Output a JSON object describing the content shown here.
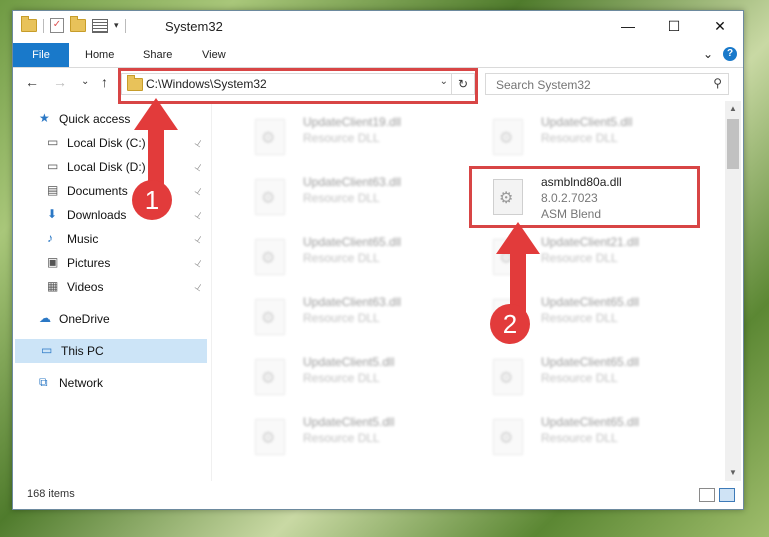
{
  "window": {
    "title": "System32",
    "controls": {
      "minimize": "—",
      "maximize": "☐",
      "close": "✕"
    }
  },
  "ribbon": {
    "tabs": [
      "File",
      "Home",
      "Share",
      "View"
    ],
    "expand": "⌄",
    "help": "?"
  },
  "navigation": {
    "back": "←",
    "forward": "→",
    "recent": "⌄",
    "up": "↑",
    "address": "C:\\Windows\\System32",
    "address_dropdown": "⌄",
    "refresh": "↻"
  },
  "search": {
    "placeholder": "Search System32",
    "icon": "⚲"
  },
  "sidebar": {
    "items": [
      {
        "label": "Quick access",
        "icon": "star-icon",
        "pinned": false
      },
      {
        "label": "Local Disk (C:)",
        "icon": "drive-icon",
        "pinned": true
      },
      {
        "label": "Local Disk (D:)",
        "icon": "drive-icon",
        "pinned": true
      },
      {
        "label": "Documents",
        "icon": "documents-icon",
        "pinned": true
      },
      {
        "label": "Downloads",
        "icon": "downloads-icon",
        "pinned": true
      },
      {
        "label": "Music",
        "icon": "music-icon",
        "pinned": true
      },
      {
        "label": "Pictures",
        "icon": "pictures-icon",
        "pinned": true
      },
      {
        "label": "Videos",
        "icon": "videos-icon",
        "pinned": true
      },
      {
        "label": "OneDrive",
        "icon": "cloud-icon",
        "pinned": false
      },
      {
        "label": "This PC",
        "icon": "computer-icon",
        "pinned": false,
        "selected": true
      },
      {
        "label": "Network",
        "icon": "network-icon",
        "pinned": false
      }
    ],
    "pin_glyph": "📌"
  },
  "files": {
    "left_column": [
      {
        "name": "UpdateClient19.dll",
        "type": "Resource DLL"
      },
      {
        "name": "UpdateClient63.dll",
        "type": "Resource DLL"
      },
      {
        "name": "UpdateClient65.dll",
        "type": "Resource DLL"
      },
      {
        "name": "UpdateClient63.dll",
        "type": "Resource DLL"
      },
      {
        "name": "UpdateClient5.dll",
        "type": "Resource DLL"
      },
      {
        "name": "UpdateClient5.dll",
        "type": "Resource DLL"
      }
    ],
    "right_column": [
      {
        "name": "UpdateClient5.dll",
        "type": "Resource DLL"
      },
      {
        "name": "UpdateClient21.dll",
        "type": "Resource DLL"
      },
      {
        "name": "UpdateClient65.dll",
        "type": "Resource DLL"
      },
      {
        "name": "UpdateClient65.dll",
        "type": "Resource DLL"
      },
      {
        "name": "UpdateClient65.dll",
        "type": "Resource DLL"
      }
    ],
    "highlighted": {
      "name": "asmblnd80a.dll",
      "version": "8.0.2.7023",
      "description": "ASM Blend"
    }
  },
  "status": {
    "item_count": "168 items"
  },
  "annotations": {
    "step1": "1",
    "step2": "2",
    "color": "#e23b3b"
  }
}
